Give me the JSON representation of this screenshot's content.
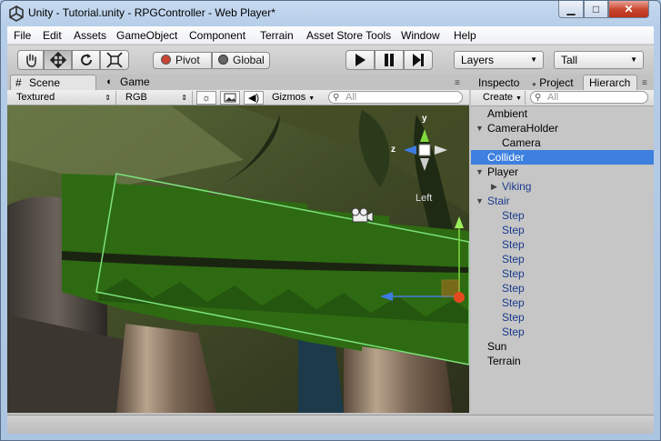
{
  "window": {
    "title": "Unity - Tutorial.unity - RPGController - Web Player*",
    "controls": {
      "minimize": "▁",
      "maximize": "□",
      "close": "✕"
    }
  },
  "menu": [
    "File",
    "Edit",
    "Assets",
    "GameObject",
    "Component",
    "Terrain",
    "Asset Store Tools",
    "Window",
    "Help"
  ],
  "toolbar": {
    "tools": [
      "hand-icon",
      "move-icon",
      "rotate-icon",
      "scale-icon"
    ],
    "active_tool": "move-icon",
    "pivot_label": "Pivot",
    "global_label": "Global",
    "play": "play-icon",
    "pause": "pause-icon",
    "step": "step-icon",
    "layers_label": "Layers",
    "layout_label": "Tall"
  },
  "scene": {
    "tabs": [
      "Scene",
      "Game"
    ],
    "active_tab": "Scene",
    "render_mode": "Textured",
    "color_mode": "RGB",
    "gizmos_label": "Gizmos",
    "search_placeholder": "All",
    "view_label": "Left",
    "axis_labels": {
      "y": "y",
      "z": "z"
    }
  },
  "right_panel": {
    "tabs": [
      "Inspector",
      "Project",
      "Hierarchy"
    ],
    "tab_text": [
      "Inspecto",
      "Project",
      "Hierarch"
    ],
    "active_tab": "Hierarchy",
    "create_label": "Create",
    "search_placeholder": "All"
  },
  "hierarchy": [
    {
      "label": "Ambient",
      "depth": 0,
      "expander": "",
      "selected": false,
      "prefab": false
    },
    {
      "label": "CameraHolder",
      "depth": 0,
      "expander": "▼",
      "selected": false,
      "prefab": false
    },
    {
      "label": "Camera",
      "depth": 2,
      "expander": "",
      "selected": false,
      "prefab": false
    },
    {
      "label": "Collider",
      "depth": 0,
      "expander": "",
      "selected": true,
      "prefab": false
    },
    {
      "label": "Player",
      "depth": 0,
      "expander": "▼",
      "selected": false,
      "prefab": false
    },
    {
      "label": "Viking",
      "depth": 1,
      "expander": "▶",
      "selected": false,
      "prefab": true
    },
    {
      "label": "Stair",
      "depth": 0,
      "expander": "▼",
      "selected": false,
      "prefab": true
    },
    {
      "label": "Step",
      "depth": 1,
      "expander": "",
      "selected": false,
      "prefab": true
    },
    {
      "label": "Step",
      "depth": 1,
      "expander": "",
      "selected": false,
      "prefab": true
    },
    {
      "label": "Step",
      "depth": 1,
      "expander": "",
      "selected": false,
      "prefab": true
    },
    {
      "label": "Step",
      "depth": 1,
      "expander": "",
      "selected": false,
      "prefab": true
    },
    {
      "label": "Step",
      "depth": 1,
      "expander": "",
      "selected": false,
      "prefab": true
    },
    {
      "label": "Step",
      "depth": 1,
      "expander": "",
      "selected": false,
      "prefab": true
    },
    {
      "label": "Step",
      "depth": 1,
      "expander": "",
      "selected": false,
      "prefab": true
    },
    {
      "label": "Step",
      "depth": 1,
      "expander": "",
      "selected": false,
      "prefab": true
    },
    {
      "label": "Step",
      "depth": 1,
      "expander": "",
      "selected": false,
      "prefab": true
    },
    {
      "label": "Sun",
      "depth": 0,
      "expander": "",
      "selected": false,
      "prefab": false
    },
    {
      "label": "Terrain",
      "depth": 0,
      "expander": "",
      "selected": false,
      "prefab": false
    }
  ],
  "colors": {
    "selection": "#3d80df",
    "prefab_text": "#1a3a8c",
    "collider_outline": "#7be27b",
    "terrain_green": "#2e6a12"
  }
}
